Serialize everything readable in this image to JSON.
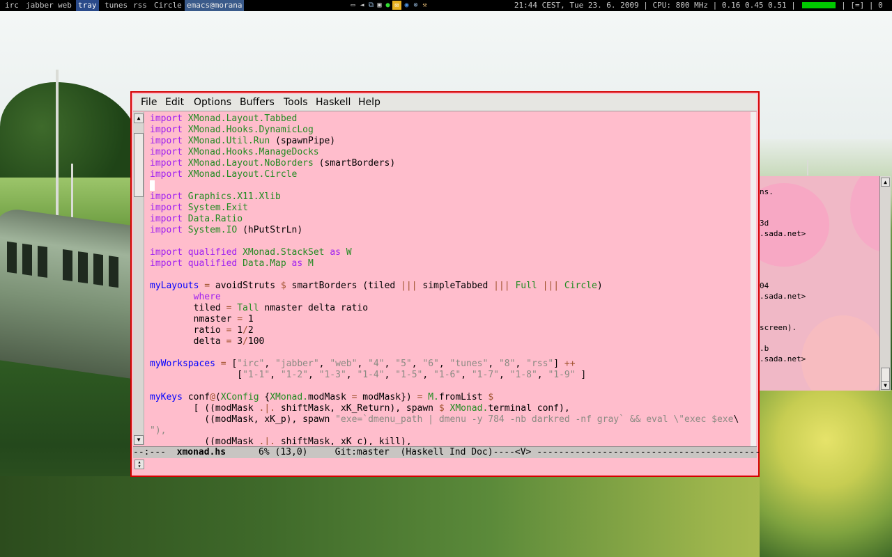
{
  "topbar": {
    "workspaces": [
      "irc",
      "jabber",
      "web",
      "tray",
      "tunes",
      "rss",
      "Circle"
    ],
    "current_workspace": "tray",
    "window_title": "emacs@morana",
    "status": {
      "clock": "21:44 CEST, Tue 23. 6. 2009",
      "cpu": "CPU: 800 MHz",
      "load": "0.16 0.45 0.51",
      "layout": "[=]",
      "count": "0"
    }
  },
  "emacs": {
    "menu": [
      "File",
      "Edit",
      "Options",
      "Buffers",
      "Tools",
      "Haskell",
      "Help"
    ],
    "code_lines": [
      "import XMonad.Layout.Tabbed",
      "import XMonad.Hooks.DynamicLog",
      "import XMonad.Util.Run (spawnPipe)",
      "import XMonad.Hooks.ManageDocks",
      "import XMonad.Layout.NoBorders (smartBorders)",
      "import XMonad.Layout.Circle",
      "",
      "import Graphics.X11.Xlib",
      "import System.Exit",
      "import Data.Ratio",
      "import System.IO (hPutStrLn)",
      "",
      "import qualified XMonad.StackSet as W",
      "import qualified Data.Map as M",
      "",
      "myLayouts = avoidStruts $ smartBorders (tiled ||| simpleTabbed ||| Full ||| Circle)",
      "        where",
      "        tiled = Tall nmaster delta ratio",
      "        nmaster = 1",
      "        ratio = 1/2",
      "        delta = 3/100",
      "",
      "myWorkspaces = [\"irc\", \"jabber\", \"web\", \"4\", \"5\", \"6\", \"tunes\", \"8\", \"rss\"] ++",
      "                [\"1-1\", \"1-2\", \"1-3\", \"1-4\", \"1-5\", \"1-6\", \"1-7\", \"1-8\", \"1-9\" ]",
      "",
      "myKeys conf@(XConfig {XMonad.modMask = modMask}) = M.fromList $",
      "        [ ((modMask .|. shiftMask, xK_Return), spawn $ XMonad.terminal conf),",
      "          ((modMask, xK_p), spawn \"exe=`dmenu_path | dmenu -y 784 -nb darkred -nf gray` && eval \\\"exec $exe\\",
      "\"),",
      "          ((modMask .|. shiftMask, xK_c), kill),"
    ],
    "modeline": {
      "prefix": "--:---  ",
      "buffer": "xmonad.hs",
      "position": "      6% (13,0)     Git:master  (Haskell Ind Doc)----<V> -----------------------------------------"
    }
  },
  "terminal": {
    "lines": [
      "",
      "ns.",
      "",
      "",
      "3d",
      ".sada.net>",
      "",
      "",
      "",
      "",
      "04",
      ".sada.net>",
      "",
      "",
      "screen).",
      "",
      ".b",
      ".sada.net>"
    ]
  },
  "colors": {
    "emacs_bg": "#ffbdcc",
    "emacs_border": "#d40000",
    "keyword": "#a020f0",
    "module": "#228b22",
    "function": "#0000ff",
    "operator": "#a0522d",
    "string": "#8b8b83",
    "current_workspace_bg": "#2a4a8a",
    "cpu_meter": "#00c800"
  },
  "icons": {
    "tray": [
      "monitor-icon",
      "speaker-icon",
      "network-icon",
      "window-icon",
      "green-circle-icon",
      "mail-icon",
      "firefox-icon",
      "settings-icon"
    ],
    "scrollbar": [
      "arrow-up-icon",
      "arrow-down-icon"
    ]
  }
}
